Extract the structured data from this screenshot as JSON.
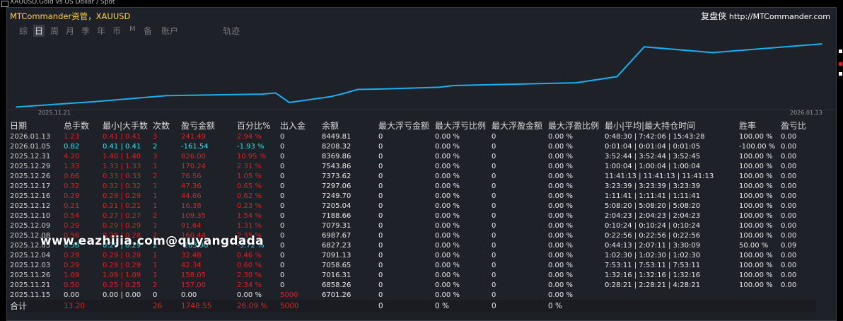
{
  "window": {
    "caption": "XAUUSD,Gold vs US Dollar / Spot",
    "title": "MTCommander资管，XAUUSD",
    "brand": "复盘侠",
    "url": "http://MTCommander.com"
  },
  "tabs": [
    {
      "label": "综",
      "active": false
    },
    {
      "label": "日",
      "active": true
    },
    {
      "label": "周",
      "active": false
    },
    {
      "label": "月",
      "active": false
    },
    {
      "label": "季",
      "active": false
    },
    {
      "label": "年",
      "active": false
    },
    {
      "label": "币",
      "active": false
    },
    {
      "label": "M",
      "active": false
    },
    {
      "label": "备",
      "active": false
    },
    {
      "label": "账户",
      "active": false
    },
    {
      "label": "轨迹",
      "active": false
    }
  ],
  "chart_data": {
    "type": "line",
    "x_start_label": "2025.11.21",
    "x_end_label": "2026.01.13",
    "x": [
      "2025.11.15",
      "2025.11.21",
      "2025.11.26",
      "2025.12.03",
      "2025.12.04",
      "2025.12.05",
      "2025.12.08",
      "2025.12.09",
      "2025.12.10",
      "2025.12.12",
      "2025.12.16",
      "2025.12.17",
      "2025.12.26",
      "2025.12.29",
      "2025.12.31",
      "2026.01.05",
      "2026.01.13"
    ],
    "series": [
      {
        "values": [
          6701.26,
          6858.26,
          7016.31,
          7058.65,
          7091.13,
          6827.23,
          6987.67,
          7079.31,
          7188.66,
          7205.04,
          7249.7,
          7297.06,
          7373.62,
          7543.86,
          8369.86,
          8208.32,
          8449.81
        ],
        "color": "#1ab0f0"
      }
    ],
    "ylim": [
      6650,
      8550
    ]
  },
  "table": {
    "headers": [
      "日期",
      "总手数",
      "最小|大手数",
      "次数",
      "盈亏金额",
      "百分比%",
      "出入金",
      "余额",
      "最大浮亏金额",
      "最大浮亏比例",
      "最大浮盈金额",
      "最大浮盈比例",
      "最小|平均|最大持仓时间",
      "胜率",
      "盈亏比"
    ],
    "rows": [
      {
        "date": "2026.01.13",
        "lots": "1.23",
        "minmax": "0.41 | 0.41",
        "count": "3",
        "pnl": "241.49",
        "pct": "2.94 %",
        "flow": "0",
        "balance": "8449.81",
        "mfl": "0",
        "mflp": "0.00 %",
        "mfp": "0",
        "mfpp": "0.00 %",
        "hold": "0:48:30 | 7:42:06 | 15:43:28",
        "win": "100.00 %",
        "ratio": "0.00",
        "tone": "red"
      },
      {
        "date": "2026.01.05",
        "lots": "0.82",
        "minmax": "0.41 | 0.41",
        "count": "2",
        "pnl": "-161.54",
        "pct": "-1.93 %",
        "flow": "0",
        "balance": "8208.32",
        "mfl": "0",
        "mflp": "0.00 %",
        "mfp": "0",
        "mfpp": "0.00 %",
        "hold": "0:01:04 | 0:01:04 | 0:01:05",
        "win": "-100.00 %",
        "ratio": "0.00",
        "tone": "cyan"
      },
      {
        "date": "2025.12.31",
        "lots": "4.20",
        "minmax": "1.40 | 1.40",
        "count": "3",
        "pnl": "826.00",
        "pct": "10.95 %",
        "flow": "0",
        "balance": "8369.86",
        "mfl": "0",
        "mflp": "0.00 %",
        "mfp": "0",
        "mfpp": "0.00 %",
        "hold": "3:52:44 | 3:52:44 | 3:52:45",
        "win": "100.00 %",
        "ratio": "0.00",
        "tone": "red"
      },
      {
        "date": "2025.12.29",
        "lots": "1.33",
        "minmax": "1.33 | 1.33",
        "count": "1",
        "pnl": "170.24",
        "pct": "2.31 %",
        "flow": "0",
        "balance": "7543.86",
        "mfl": "0",
        "mflp": "0.00 %",
        "mfp": "0",
        "mfpp": "0.00 %",
        "hold": "1:00:04 | 1:00:04 | 1:00:04",
        "win": "100.00 %",
        "ratio": "0.00",
        "tone": "red"
      },
      {
        "date": "2025.12.26",
        "lots": "0.66",
        "minmax": "0.33 | 0.33",
        "count": "2",
        "pnl": "76.56",
        "pct": "1.05 %",
        "flow": "0",
        "balance": "7373.62",
        "mfl": "0",
        "mflp": "0.00 %",
        "mfp": "0",
        "mfpp": "0.00 %",
        "hold": "11:41:13 | 11:41:13 | 11:41:13",
        "win": "100.00 %",
        "ratio": "0.00",
        "tone": "red"
      },
      {
        "date": "2025.12.17",
        "lots": "0.32",
        "minmax": "0.32 | 0.32",
        "count": "1",
        "pnl": "47.36",
        "pct": "0.65 %",
        "flow": "0",
        "balance": "7297.06",
        "mfl": "0",
        "mflp": "0.00 %",
        "mfp": "0",
        "mfpp": "0.00 %",
        "hold": "3:23:39 | 3:23:39 | 3:23:39",
        "win": "100.00 %",
        "ratio": "0.00",
        "tone": "red"
      },
      {
        "date": "2025.12.16",
        "lots": "0.29",
        "minmax": "0.29 | 0.29",
        "count": "1",
        "pnl": "44.66",
        "pct": "0.62 %",
        "flow": "0",
        "balance": "7249.70",
        "mfl": "0",
        "mflp": "0.00 %",
        "mfp": "0",
        "mfpp": "0.00 %",
        "hold": "1:11:41 | 1:11:41 | 1:11:41",
        "win": "100.00 %",
        "ratio": "0.00",
        "tone": "red"
      },
      {
        "date": "2025.12.12",
        "lots": "0.21",
        "minmax": "0.21 | 0.21",
        "count": "1",
        "pnl": "16.38",
        "pct": "0.23 %",
        "flow": "0",
        "balance": "7205.04",
        "mfl": "0",
        "mflp": "0.00 %",
        "mfp": "0",
        "mfpp": "0.00 %",
        "hold": "5:08:20 | 5:08:20 | 5:08:20",
        "win": "100.00 %",
        "ratio": "0.00",
        "tone": "red"
      },
      {
        "date": "2025.12.10",
        "lots": "0.54",
        "minmax": "0.27 | 0.27",
        "count": "2",
        "pnl": "109.35",
        "pct": "1.54 %",
        "flow": "0",
        "balance": "7188.66",
        "mfl": "0",
        "mflp": "0.00 %",
        "mfp": "0",
        "mfpp": "0.00 %",
        "hold": "2:04:23 | 2:04:23 | 2:04:23",
        "win": "100.00 %",
        "ratio": "0.00",
        "tone": "red"
      },
      {
        "date": "2025.12.09",
        "lots": "0.29",
        "minmax": "0.29 | 0.29",
        "count": "1",
        "pnl": "91.64",
        "pct": "1.31 %",
        "flow": "0",
        "balance": "7079.31",
        "mfl": "0",
        "mflp": "0.00 %",
        "mfp": "0",
        "mfpp": "0.00 %",
        "hold": "0:10:24 | 0:10:24 | 0:10:24",
        "win": "100.00 %",
        "ratio": "0.00",
        "tone": "red"
      },
      {
        "date": "2025.12.08",
        "lots": "0.56",
        "minmax": "0.28 | 0.28",
        "count": "2",
        "pnl": "160.44",
        "pct": "2.35 %",
        "flow": "0",
        "balance": "6987.67",
        "mfl": "0",
        "mflp": "0.00 %",
        "mfp": "0",
        "mfpp": "0.00 %",
        "hold": "0:22:56 | 0:22:56 | 0:22:56",
        "win": "100.00 %",
        "ratio": "0.00",
        "tone": "red"
      },
      {
        "date": "2025.12.05",
        "lots": "0.58",
        "minmax": "0.29 | 0.29",
        "count": "2",
        "pnl": "-263.90",
        "pct": "-3.72 %",
        "flow": "0",
        "balance": "6827.23",
        "mfl": "0",
        "mflp": "0.00 %",
        "mfp": "0",
        "mfpp": "0.00 %",
        "hold": "0:44:13 | 2:07:11 | 3:30:09",
        "win": "50.00 %",
        "ratio": "0.09",
        "tone": "cyan"
      },
      {
        "date": "2025.12.04",
        "lots": "0.29",
        "minmax": "0.29 | 0.29",
        "count": "1",
        "pnl": "32.48",
        "pct": "0.46 %",
        "flow": "0",
        "balance": "7091.13",
        "mfl": "0",
        "mflp": "0.00 %",
        "mfp": "0",
        "mfpp": "0.00 %",
        "hold": "1:02:30 | 1:02:30 | 1:02:30",
        "win": "100.00 %",
        "ratio": "0.00",
        "tone": "red"
      },
      {
        "date": "2025.12.03",
        "lots": "0.29",
        "minmax": "0.29 | 0.29",
        "count": "1",
        "pnl": "42.34",
        "pct": "0.60 %",
        "flow": "0",
        "balance": "7058.65",
        "mfl": "0",
        "mflp": "0.00 %",
        "mfp": "0",
        "mfpp": "0.00 %",
        "hold": "7:53:11 | 7:53:11 | 7:53:11",
        "win": "100.00 %",
        "ratio": "0.00",
        "tone": "red"
      },
      {
        "date": "2025.11.26",
        "lots": "1.09",
        "minmax": "1.09 | 1.09",
        "count": "1",
        "pnl": "158.05",
        "pct": "2.30 %",
        "flow": "0",
        "balance": "7016.31",
        "mfl": "0",
        "mflp": "0.00 %",
        "mfp": "0",
        "mfpp": "0.00 %",
        "hold": "1:32:16 | 1:32:16 | 1:32:16",
        "win": "100.00 %",
        "ratio": "0.00",
        "tone": "red"
      },
      {
        "date": "2025.11.21",
        "lots": "0.50",
        "minmax": "0.25 | 0.25",
        "count": "2",
        "pnl": "157.00",
        "pct": "2.34 %",
        "flow": "0",
        "balance": "6858.26",
        "mfl": "0",
        "mflp": "0.00 %",
        "mfp": "0",
        "mfpp": "0.00 %",
        "hold": "0:28:21 | 2:28:21 | 4:28:21",
        "win": "100.00 %",
        "ratio": "0.00",
        "tone": "red"
      },
      {
        "date": "2025.11.15",
        "lots": "0.00",
        "minmax": "0.00 | 0.00",
        "count": "0",
        "pnl": "0.00",
        "pct": "0.00 %",
        "flow": "5000",
        "balance": "6701.26",
        "mfl": "0",
        "mflp": "0.00 %",
        "mfp": "0",
        "mfpp": "0.00 %",
        "hold": "",
        "win": "",
        "ratio": "",
        "tone": "white"
      }
    ],
    "total": {
      "label": "合计",
      "lots": "13.20",
      "count": "26",
      "pnl": "1748.55",
      "pct": "26.09 %",
      "flow": "5000",
      "mfl": "0",
      "mflp": "0 %",
      "mfp": "0",
      "mfpp": "0 %"
    }
  },
  "watermark": "www.eazhijia.com@quyangdada",
  "colors": {
    "accent": "#ffd24a",
    "line": "#1ab0f0",
    "gain": "#e02020",
    "loss": "#2ee6f0",
    "panel": "#1e2128"
  }
}
